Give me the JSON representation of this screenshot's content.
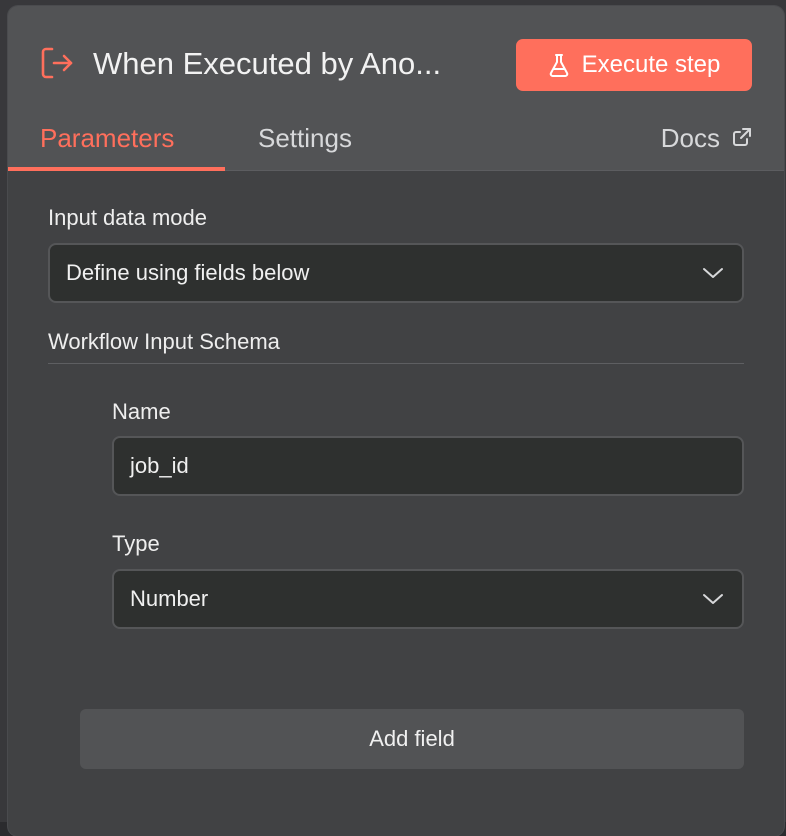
{
  "header": {
    "title": "When Executed by Ano...",
    "node_icon": "sign-in-arrow-icon",
    "execute_button_label": "Execute step",
    "execute_icon": "flask-icon"
  },
  "tabs": {
    "parameters": "Parameters",
    "settings": "Settings",
    "active": "Parameters"
  },
  "docs": {
    "label": "Docs",
    "icon": "external-link-icon"
  },
  "input_mode": {
    "label": "Input data mode",
    "value": "Define using fields below"
  },
  "schema": {
    "title": "Workflow Input Schema",
    "fields": [
      {
        "name_label": "Name",
        "name_value": "job_id",
        "type_label": "Type",
        "type_value": "Number"
      }
    ]
  },
  "add_field_label": "Add field",
  "colors": {
    "accent": "#ff6f5c",
    "panel": "#414244",
    "header": "#525355",
    "input_bg": "#2e302f"
  }
}
